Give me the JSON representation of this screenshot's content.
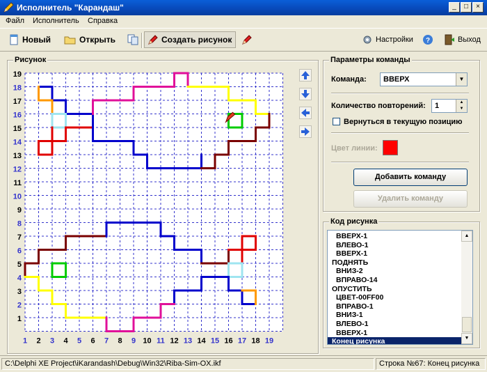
{
  "window": {
    "title": "Исполнитель \"Карандаш\"",
    "controls": {
      "minimize": "_",
      "maximize": "□",
      "close": "×"
    }
  },
  "menu": [
    "Файл",
    "Исполнитель",
    "Справка"
  ],
  "toolbar": {
    "new_label": "Новый",
    "open_label": "Открыть",
    "create_label": "Создать рисунок",
    "settings_label": "Настройки",
    "exit_label": "Выход",
    "help_icon": "?"
  },
  "drawing": {
    "title": "Рисунок",
    "y_labels": [
      "19",
      "18",
      "17",
      "16",
      "15",
      "14",
      "13",
      "12",
      "11",
      "10",
      "9",
      "8",
      "7",
      "6",
      "5",
      "4",
      "3",
      "2",
      "1"
    ],
    "x_labels": [
      "1",
      "2",
      "3",
      "4",
      "5",
      "6",
      "7",
      "8",
      "9",
      "10",
      "11",
      "12",
      "13",
      "14",
      "15",
      "16",
      "17",
      "18",
      "19"
    ],
    "label_colors": {
      "dark": "#000000",
      "blue": "#3333cc"
    },
    "grid_color": "#3333cc",
    "colors": {
      "red": "#e00000",
      "blue": "#0000cc",
      "orange": "#ff9900",
      "lightblue": "#9fe5f0",
      "magenta": "#e0109a",
      "yellow": "#ffff00",
      "darkred": "#7a0000",
      "green": "#00cc00"
    }
  },
  "params": {
    "title": "Параметры команды",
    "command_label": "Команда:",
    "command_value": "ВВЕРХ",
    "repeat_label": "Количество повторений:",
    "repeat_value": "1",
    "return_label": "Вернуться в текущую позицию",
    "return_checked": false,
    "line_color_label": "Цвет линии:",
    "line_color": "#ff0000",
    "add_button": "Добавить команду",
    "delete_button": "Удалить команду"
  },
  "code": {
    "title": "Код рисунка",
    "lines": [
      "ВВЕРХ-1",
      "ВЛЕВО-1",
      "ВВЕРХ-1",
      "ПОДНЯТЬ",
      "ВНИЗ-2",
      "ВПРАВО-14",
      "ОПУСТИТЬ",
      "ЦВЕТ-00FF00",
      "ВПРАВО-1",
      "ВНИЗ-1",
      "ВЛЕВО-1",
      "ВВЕРХ-1",
      "Конец рисунка"
    ],
    "selected_index": 12
  },
  "status": {
    "path": "C:\\Delphi XE Project\\iKarandash\\Debug\\Win32\\Riba-Sim-OX.ikf",
    "line": "Строка №67:",
    "command": "Конец рисунка"
  }
}
